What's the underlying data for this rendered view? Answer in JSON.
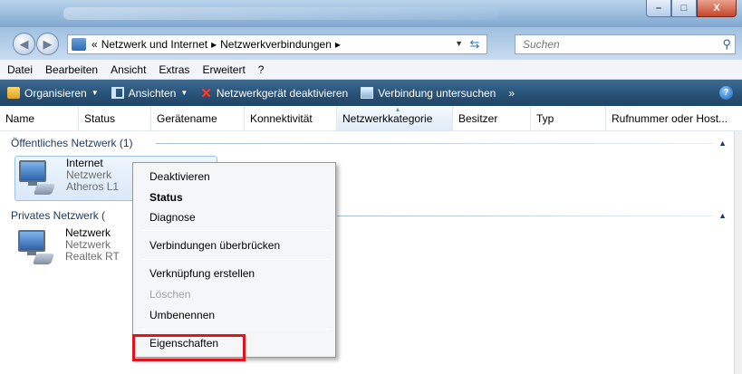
{
  "address": {
    "crumb_prefix": "«",
    "crumb1": "Netzwerk und Internet",
    "sep": "▸",
    "crumb2": "Netzwerkverbindungen",
    "crumb_end": "▸"
  },
  "search": {
    "placeholder": "Suchen"
  },
  "window_buttons": {
    "minimize": "–",
    "maximize": "□",
    "close": "X"
  },
  "menubar": [
    "Datei",
    "Bearbeiten",
    "Ansicht",
    "Extras",
    "Erweitert",
    "?"
  ],
  "toolbar": {
    "organize": "Organisieren",
    "views": "Ansichten",
    "disable": "Netzwerkgerät deaktivieren",
    "diagnose": "Verbindung untersuchen",
    "more": "»",
    "help": "?"
  },
  "columns": [
    "Name",
    "Status",
    "Gerätename",
    "Konnektivität",
    "Netzwerkkategorie",
    "Besitzer",
    "Typ",
    "Rufnummer oder Host..."
  ],
  "groups": [
    {
      "title": "Öffentliches Netzwerk (1)",
      "item": {
        "name": "Internet",
        "status": "Netzwerk",
        "device": "Atheros L1"
      }
    },
    {
      "title": "Privates Netzwerk (",
      "item": {
        "name": "Netzwerk",
        "status": "Netzwerk",
        "device": "Realtek RT"
      }
    }
  ],
  "context_menu": {
    "deactivate": "Deaktivieren",
    "status": "Status",
    "diagnose": "Diagnose",
    "bridge": "Verbindungen überbrücken",
    "shortcut": "Verknüpfung erstellen",
    "delete": "Löschen",
    "rename": "Umbenennen",
    "properties": "Eigenschaften"
  },
  "colors": {
    "toolbar": "#2a5479",
    "highlight": "#e2131b",
    "group_text": "#1e395b"
  }
}
